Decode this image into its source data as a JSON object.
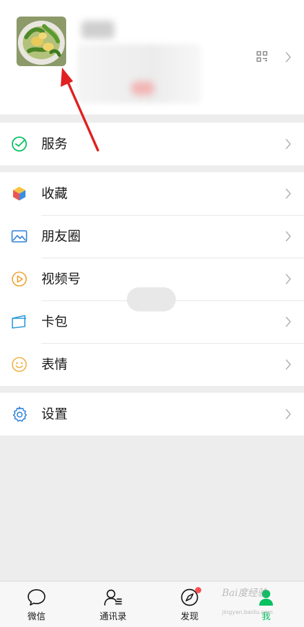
{
  "menu": {
    "services": "服务",
    "favorites": "收藏",
    "moments": "朋友圈",
    "channels": "视频号",
    "cards": "卡包",
    "stickers": "表情",
    "settings": "设置"
  },
  "tabs": [
    {
      "label": "微信"
    },
    {
      "label": "通讯录"
    },
    {
      "label": "发现"
    },
    {
      "label": "我"
    }
  ],
  "watermark": {
    "line1": "Bai度经验",
    "line2": "jingyan.baidu.com"
  },
  "colors": {
    "accent_green": "#07c160",
    "annotation_red": "#e02020",
    "badge_red": "#fa5151",
    "moments_blue": "#2b7fd8",
    "channels_orange": "#f0a030",
    "stickers_yellow": "#f0b040",
    "settings_blue": "#2b7fd8"
  },
  "icons": [
    "qr-code-icon",
    "chevron-right-icon",
    "services-icon",
    "favorites-icon",
    "moments-icon",
    "channels-icon",
    "card-wallet-icon",
    "smiley-icon",
    "gear-icon",
    "chat-icon",
    "contacts-icon",
    "compass-icon",
    "me-icon"
  ]
}
